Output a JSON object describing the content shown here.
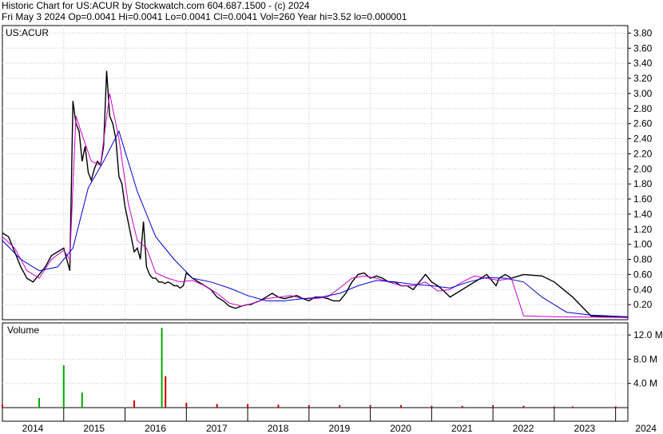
{
  "header": {
    "line1": "Historic Chart for US:ACUR by Stockwatch.com 604.687.1500 - (c) 2024",
    "line2": "Fri May  3 2024   Op=0.0041   Hi=0.0041   Lo=0.0041   Cl=0.0041   Vol=260   Year hi=3.52   lo=0.000001"
  },
  "chart_data": [
    {
      "type": "line",
      "panel": "price",
      "title": "US:ACUR",
      "ylim": [
        0,
        3.9
      ],
      "yticks": [
        "0.20",
        "0.40",
        "0.60",
        "0.80",
        "1.00",
        "1.20",
        "1.40",
        "1.60",
        "1.80",
        "2.00",
        "2.20",
        "2.40",
        "2.60",
        "2.80",
        "3.00",
        "3.20",
        "3.40",
        "3.60",
        "3.80"
      ],
      "xlim": [
        2014.0,
        2024.2
      ],
      "x_tick_labels": [
        "2014",
        "2015",
        "2016",
        "2017",
        "2018",
        "2019",
        "2020",
        "2021",
        "2022",
        "2023",
        "2024"
      ],
      "grid": true,
      "series": [
        {
          "color": "#000000",
          "x": [
            2014.0,
            2014.1,
            2014.2,
            2014.3,
            2014.4,
            2014.5,
            2014.6,
            2014.7,
            2014.8,
            2014.9,
            2015.0,
            2015.1,
            2015.15,
            2015.2,
            2015.25,
            2015.3,
            2015.35,
            2015.4,
            2015.45,
            2015.5,
            2015.55,
            2015.6,
            2015.65,
            2015.7,
            2015.75,
            2015.8,
            2015.85,
            2015.9,
            2015.95,
            2016.0,
            2016.05,
            2016.1,
            2016.15,
            2016.2,
            2016.25,
            2016.3,
            2016.35,
            2016.4,
            2016.45,
            2016.5,
            2016.55,
            2016.6,
            2016.65,
            2016.7,
            2016.75,
            2016.8,
            2016.85,
            2016.9,
            2016.95,
            2017.0,
            2017.1,
            2017.2,
            2017.3,
            2017.4,
            2017.5,
            2017.6,
            2017.7,
            2017.8,
            2017.9,
            2018.0,
            2018.05,
            2018.1,
            2018.2,
            2018.3,
            2018.4,
            2018.5,
            2018.6,
            2018.7,
            2018.8,
            2018.9,
            2019.0,
            2019.1,
            2019.2,
            2019.3,
            2019.4,
            2019.5,
            2019.6,
            2019.7,
            2019.8,
            2019.9,
            2020.0,
            2020.1,
            2020.2,
            2020.3,
            2020.4,
            2020.5,
            2020.6,
            2020.7,
            2020.8,
            2020.9,
            2021.0,
            2021.1,
            2021.2,
            2021.3,
            2021.4,
            2021.5,
            2021.6,
            2021.7,
            2021.8,
            2021.9,
            2022.0,
            2022.05,
            2022.1,
            2022.2,
            2022.3,
            2022.5,
            2022.8,
            2023.0,
            2023.3,
            2023.6,
            2023.9,
            2024.2
          ],
          "y": [
            1.15,
            1.1,
            0.9,
            0.7,
            0.55,
            0.5,
            0.6,
            0.7,
            0.85,
            0.9,
            0.95,
            0.65,
            2.9,
            2.6,
            2.5,
            2.1,
            2.3,
            1.95,
            1.85,
            2.0,
            2.1,
            2.05,
            2.3,
            3.3,
            2.7,
            2.6,
            2.4,
            1.9,
            1.8,
            1.5,
            1.3,
            1.1,
            0.9,
            0.95,
            0.8,
            1.3,
            0.7,
            0.6,
            0.55,
            0.55,
            0.5,
            0.5,
            0.48,
            0.5,
            0.48,
            0.45,
            0.45,
            0.42,
            0.45,
            0.62,
            0.55,
            0.5,
            0.45,
            0.4,
            0.3,
            0.25,
            0.18,
            0.15,
            0.18,
            0.2,
            0.2,
            0.22,
            0.25,
            0.3,
            0.35,
            0.3,
            0.28,
            0.3,
            0.32,
            0.28,
            0.25,
            0.3,
            0.3,
            0.28,
            0.25,
            0.25,
            0.35,
            0.5,
            0.6,
            0.62,
            0.55,
            0.58,
            0.55,
            0.5,
            0.5,
            0.45,
            0.45,
            0.4,
            0.5,
            0.6,
            0.5,
            0.45,
            0.38,
            0.3,
            0.35,
            0.4,
            0.45,
            0.5,
            0.55,
            0.6,
            0.5,
            0.45,
            0.55,
            0.6,
            0.55,
            0.6,
            0.58,
            0.5,
            0.3,
            0.05,
            0.04,
            0.03
          ]
        },
        {
          "color": "#cc00cc",
          "x": [
            2014.0,
            2014.2,
            2014.4,
            2014.6,
            2014.8,
            2015.0,
            2015.1,
            2015.2,
            2015.3,
            2015.45,
            2015.6,
            2015.75,
            2015.9,
            2016.05,
            2016.2,
            2016.35,
            2016.5,
            2016.7,
            2016.9,
            2017.1,
            2017.3,
            2017.5,
            2017.7,
            2017.9,
            2018.1,
            2018.3,
            2018.5,
            2018.7,
            2018.9,
            2019.1,
            2019.3,
            2019.5,
            2019.7,
            2019.9,
            2020.1,
            2020.3,
            2020.5,
            2020.7,
            2020.9,
            2021.1,
            2021.3,
            2021.5,
            2021.7,
            2021.9,
            2022.1,
            2022.3,
            2022.5,
            2023.0,
            2024.2
          ],
          "y": [
            1.1,
            0.95,
            0.65,
            0.55,
            0.8,
            0.92,
            0.8,
            2.7,
            2.45,
            2.1,
            2.05,
            3.0,
            2.4,
            1.55,
            1.05,
            0.95,
            0.62,
            0.55,
            0.5,
            0.52,
            0.45,
            0.35,
            0.22,
            0.18,
            0.22,
            0.28,
            0.3,
            0.32,
            0.28,
            0.28,
            0.3,
            0.42,
            0.55,
            0.58,
            0.55,
            0.5,
            0.45,
            0.45,
            0.5,
            0.38,
            0.4,
            0.5,
            0.58,
            0.55,
            0.52,
            0.55,
            0.05,
            0.04,
            0.03
          ]
        },
        {
          "color": "#0000cc",
          "x": [
            2014.0,
            2014.3,
            2014.6,
            2014.9,
            2015.15,
            2015.4,
            2015.65,
            2015.9,
            2016.2,
            2016.5,
            2016.8,
            2017.1,
            2017.4,
            2017.7,
            2018.0,
            2018.3,
            2018.6,
            2018.9,
            2019.2,
            2019.5,
            2019.8,
            2020.1,
            2020.4,
            2020.7,
            2021.0,
            2021.3,
            2021.6,
            2021.9,
            2022.2,
            2022.5,
            2022.8,
            2023.2,
            2023.6,
            2024.2
          ],
          "y": [
            1.05,
            0.8,
            0.65,
            0.7,
            0.95,
            1.75,
            2.1,
            2.5,
            1.7,
            1.1,
            0.8,
            0.55,
            0.5,
            0.42,
            0.32,
            0.25,
            0.25,
            0.28,
            0.3,
            0.35,
            0.45,
            0.52,
            0.5,
            0.47,
            0.45,
            0.42,
            0.5,
            0.56,
            0.55,
            0.5,
            0.3,
            0.1,
            0.06,
            0.04
          ]
        }
      ]
    },
    {
      "type": "bar",
      "panel": "volume",
      "title": "Volume",
      "ylim": [
        0,
        14
      ],
      "yticks": [
        "4.0 M",
        "8.0 M",
        "12.0 M"
      ],
      "x": [
        2014.0,
        2014.6,
        2015.0,
        2015.3,
        2016.15,
        2016.6,
        2016.66,
        2017.0,
        2017.5,
        2018.0,
        2018.5,
        2019.0,
        2019.5,
        2020.0,
        2020.5,
        2021.0,
        2021.5,
        2022.0,
        2022.5,
        2023.0,
        2023.3,
        2024.0
      ],
      "values": [
        0.5,
        1.6,
        7.0,
        2.5,
        1.2,
        13.2,
        5.2,
        0.8,
        0.6,
        0.6,
        0.5,
        0.4,
        0.4,
        0.4,
        0.4,
        0.3,
        0.3,
        0.4,
        0.3,
        0.2,
        0.2,
        0.2
      ],
      "colors": [
        "#cc0000",
        "#00aa00",
        "#00aa00",
        "#00aa00",
        "#cc0000",
        "#00aa00",
        "#cc0000",
        "#cc0000",
        "#cc0000",
        "#cc0000",
        "#cc0000",
        "#cc0000",
        "#cc0000",
        "#cc0000",
        "#cc0000",
        "#cc0000",
        "#cc0000",
        "#cc0000",
        "#cc0000",
        "#cc0000",
        "#cc0000",
        "#cc0000"
      ]
    }
  ]
}
